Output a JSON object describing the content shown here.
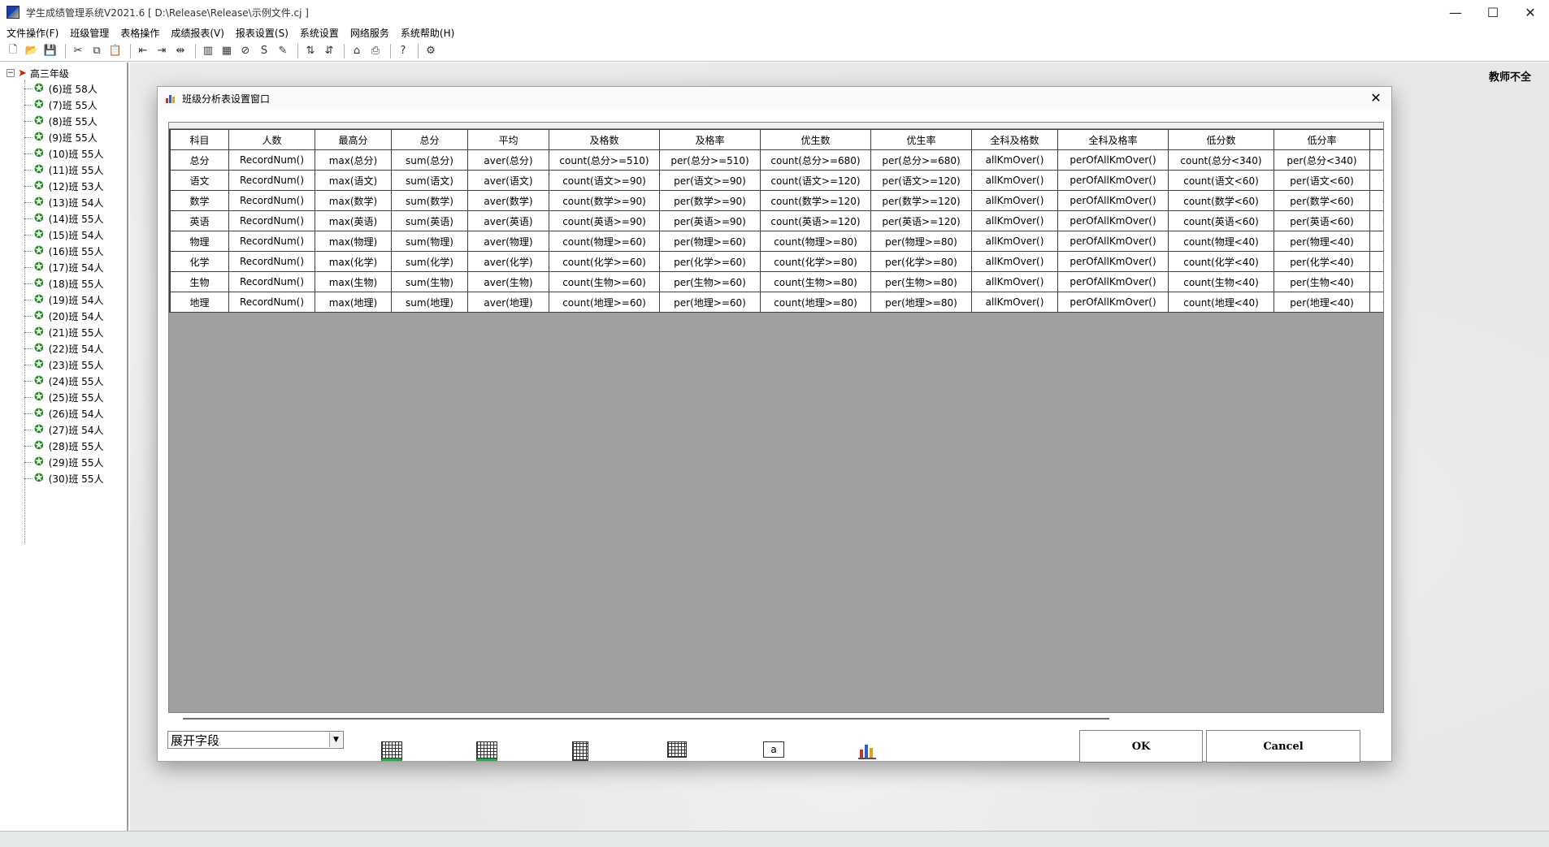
{
  "window": {
    "title": "学生成绩管理系统V2021.6 [ D:\\Release\\Release\\示例文件.cj ]",
    "minimize_label": "—",
    "maximize_label": "☐",
    "close_label": "✕"
  },
  "menu": [
    "文件操作(F)",
    "班级管理",
    "表格操作",
    "成绩报表(V)",
    "报表设置(S)",
    "系统设置",
    "网络服务",
    "系统帮助(H)"
  ],
  "tree": {
    "root_label": "高三年级",
    "expander": "−",
    "items": [
      "(6)班 58人",
      "(7)班 55人",
      "(8)班 55人",
      "(9)班 55人",
      "(10)班 55人",
      "(11)班 55人",
      "(12)班 53人",
      "(13)班 54人",
      "(14)班 55人",
      "(15)班 54人",
      "(16)班 55人",
      "(17)班 54人",
      "(18)班 55人",
      "(19)班 54人",
      "(20)班 54人",
      "(21)班 55人",
      "(22)班 54人",
      "(23)班 55人",
      "(24)班 55人",
      "(25)班 55人",
      "(26)班 54人",
      "(27)班 54人",
      "(28)班 55人",
      "(29)班 55人",
      "(30)班 55人"
    ]
  },
  "main": {
    "teacher_label": "教师不全"
  },
  "dialog": {
    "title": "班级分析表设置窗口",
    "close_label": "✕",
    "columns": [
      "科目",
      "人数",
      "最高分",
      "总分",
      "平均",
      "及格数",
      "及格率",
      "优生数",
      "优生率",
      "全科及格数",
      "全科及格率",
      "低分数",
      "低分率",
      ""
    ],
    "rows": [
      [
        "总分",
        "RecordNum()",
        "max(总分)",
        "sum(总分)",
        "aver(总分)",
        "count(总分>=510)",
        "per(总分>=510)",
        "count(总分>=680)",
        "per(总分>=680)",
        "allKmOver()",
        "perOfAllKmOver()",
        "count(总分<340)",
        "per(总分<340)",
        "="
      ],
      [
        "语文",
        "RecordNum()",
        "max(语文)",
        "sum(语文)",
        "aver(语文)",
        "count(语文>=90)",
        "per(语文>=90)",
        "count(语文>=120)",
        "per(语文>=120)",
        "allKmOver()",
        "perOfAllKmOver()",
        "count(语文<60)",
        "per(语文<60)",
        "="
      ],
      [
        "数学",
        "RecordNum()",
        "max(数学)",
        "sum(数学)",
        "aver(数学)",
        "count(数学>=90)",
        "per(数学>=90)",
        "count(数学>=120)",
        "per(数学>=120)",
        "allKmOver()",
        "perOfAllKmOver()",
        "count(数学<60)",
        "per(数学<60)",
        "="
      ],
      [
        "英语",
        "RecordNum()",
        "max(英语)",
        "sum(英语)",
        "aver(英语)",
        "count(英语>=90)",
        "per(英语>=90)",
        "count(英语>=120)",
        "per(英语>=120)",
        "allKmOver()",
        "perOfAllKmOver()",
        "count(英语<60)",
        "per(英语<60)",
        "="
      ],
      [
        "物理",
        "RecordNum()",
        "max(物理)",
        "sum(物理)",
        "aver(物理)",
        "count(物理>=60)",
        "per(物理>=60)",
        "count(物理>=80)",
        "per(物理>=80)",
        "allKmOver()",
        "perOfAllKmOver()",
        "count(物理<40)",
        "per(物理<40)",
        "="
      ],
      [
        "化学",
        "RecordNum()",
        "max(化学)",
        "sum(化学)",
        "aver(化学)",
        "count(化学>=60)",
        "per(化学>=60)",
        "count(化学>=80)",
        "per(化学>=80)",
        "allKmOver()",
        "perOfAllKmOver()",
        "count(化学<40)",
        "per(化学<40)",
        "="
      ],
      [
        "生物",
        "RecordNum()",
        "max(生物)",
        "sum(生物)",
        "aver(生物)",
        "count(生物>=60)",
        "per(生物>=60)",
        "count(生物>=80)",
        "per(生物>=80)",
        "allKmOver()",
        "perOfAllKmOver()",
        "count(生物<40)",
        "per(生物<40)",
        "="
      ],
      [
        "地理",
        "RecordNum()",
        "max(地理)",
        "sum(地理)",
        "aver(地理)",
        "count(地理>=60)",
        "per(地理>=60)",
        "count(地理>=80)",
        "per(地理>=80)",
        "allKmOver()",
        "perOfAllKmOver()",
        "count(地理<40)",
        "per(地理<40)",
        "="
      ]
    ],
    "combo_value": "展开字段",
    "combo_arrow": "▼",
    "ok_label": "OK",
    "cancel_label": "Cancel"
  },
  "colors": {
    "grid_background": "#a0a0a0",
    "tree_star": "#1d8a1d",
    "root_arrow": "#cc2200"
  }
}
